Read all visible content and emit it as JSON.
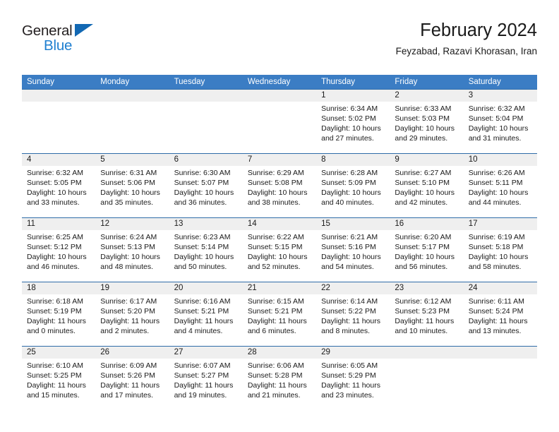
{
  "brand": {
    "name_top": "General",
    "name_bottom": "Blue",
    "color_black": "#231f20",
    "color_blue": "#1f7fd0"
  },
  "header": {
    "title": "February 2024",
    "location": "Feyzabad, Razavi Khorasan, Iran"
  },
  "theme": {
    "header_bar": "#3b7dc4",
    "row_divider": "#2f6ca8",
    "daynum_band": "#efefef",
    "text": "#1a1a1a"
  },
  "weekdays": [
    "Sunday",
    "Monday",
    "Tuesday",
    "Wednesday",
    "Thursday",
    "Friday",
    "Saturday"
  ],
  "weeks": [
    [
      {
        "day": "",
        "sunrise": "",
        "sunset": "",
        "daylight_1": "",
        "daylight_2": "",
        "empty": true
      },
      {
        "day": "",
        "sunrise": "",
        "sunset": "",
        "daylight_1": "",
        "daylight_2": "",
        "empty": true
      },
      {
        "day": "",
        "sunrise": "",
        "sunset": "",
        "daylight_1": "",
        "daylight_2": "",
        "empty": true
      },
      {
        "day": "",
        "sunrise": "",
        "sunset": "",
        "daylight_1": "",
        "daylight_2": "",
        "empty": true
      },
      {
        "day": "1",
        "sunrise": "Sunrise: 6:34 AM",
        "sunset": "Sunset: 5:02 PM",
        "daylight_1": "Daylight: 10 hours",
        "daylight_2": "and 27 minutes.",
        "empty": false
      },
      {
        "day": "2",
        "sunrise": "Sunrise: 6:33 AM",
        "sunset": "Sunset: 5:03 PM",
        "daylight_1": "Daylight: 10 hours",
        "daylight_2": "and 29 minutes.",
        "empty": false
      },
      {
        "day": "3",
        "sunrise": "Sunrise: 6:32 AM",
        "sunset": "Sunset: 5:04 PM",
        "daylight_1": "Daylight: 10 hours",
        "daylight_2": "and 31 minutes.",
        "empty": false
      }
    ],
    [
      {
        "day": "4",
        "sunrise": "Sunrise: 6:32 AM",
        "sunset": "Sunset: 5:05 PM",
        "daylight_1": "Daylight: 10 hours",
        "daylight_2": "and 33 minutes.",
        "empty": false
      },
      {
        "day": "5",
        "sunrise": "Sunrise: 6:31 AM",
        "sunset": "Sunset: 5:06 PM",
        "daylight_1": "Daylight: 10 hours",
        "daylight_2": "and 35 minutes.",
        "empty": false
      },
      {
        "day": "6",
        "sunrise": "Sunrise: 6:30 AM",
        "sunset": "Sunset: 5:07 PM",
        "daylight_1": "Daylight: 10 hours",
        "daylight_2": "and 36 minutes.",
        "empty": false
      },
      {
        "day": "7",
        "sunrise": "Sunrise: 6:29 AM",
        "sunset": "Sunset: 5:08 PM",
        "daylight_1": "Daylight: 10 hours",
        "daylight_2": "and 38 minutes.",
        "empty": false
      },
      {
        "day": "8",
        "sunrise": "Sunrise: 6:28 AM",
        "sunset": "Sunset: 5:09 PM",
        "daylight_1": "Daylight: 10 hours",
        "daylight_2": "and 40 minutes.",
        "empty": false
      },
      {
        "day": "9",
        "sunrise": "Sunrise: 6:27 AM",
        "sunset": "Sunset: 5:10 PM",
        "daylight_1": "Daylight: 10 hours",
        "daylight_2": "and 42 minutes.",
        "empty": false
      },
      {
        "day": "10",
        "sunrise": "Sunrise: 6:26 AM",
        "sunset": "Sunset: 5:11 PM",
        "daylight_1": "Daylight: 10 hours",
        "daylight_2": "and 44 minutes.",
        "empty": false
      }
    ],
    [
      {
        "day": "11",
        "sunrise": "Sunrise: 6:25 AM",
        "sunset": "Sunset: 5:12 PM",
        "daylight_1": "Daylight: 10 hours",
        "daylight_2": "and 46 minutes.",
        "empty": false
      },
      {
        "day": "12",
        "sunrise": "Sunrise: 6:24 AM",
        "sunset": "Sunset: 5:13 PM",
        "daylight_1": "Daylight: 10 hours",
        "daylight_2": "and 48 minutes.",
        "empty": false
      },
      {
        "day": "13",
        "sunrise": "Sunrise: 6:23 AM",
        "sunset": "Sunset: 5:14 PM",
        "daylight_1": "Daylight: 10 hours",
        "daylight_2": "and 50 minutes.",
        "empty": false
      },
      {
        "day": "14",
        "sunrise": "Sunrise: 6:22 AM",
        "sunset": "Sunset: 5:15 PM",
        "daylight_1": "Daylight: 10 hours",
        "daylight_2": "and 52 minutes.",
        "empty": false
      },
      {
        "day": "15",
        "sunrise": "Sunrise: 6:21 AM",
        "sunset": "Sunset: 5:16 PM",
        "daylight_1": "Daylight: 10 hours",
        "daylight_2": "and 54 minutes.",
        "empty": false
      },
      {
        "day": "16",
        "sunrise": "Sunrise: 6:20 AM",
        "sunset": "Sunset: 5:17 PM",
        "daylight_1": "Daylight: 10 hours",
        "daylight_2": "and 56 minutes.",
        "empty": false
      },
      {
        "day": "17",
        "sunrise": "Sunrise: 6:19 AM",
        "sunset": "Sunset: 5:18 PM",
        "daylight_1": "Daylight: 10 hours",
        "daylight_2": "and 58 minutes.",
        "empty": false
      }
    ],
    [
      {
        "day": "18",
        "sunrise": "Sunrise: 6:18 AM",
        "sunset": "Sunset: 5:19 PM",
        "daylight_1": "Daylight: 11 hours",
        "daylight_2": "and 0 minutes.",
        "empty": false
      },
      {
        "day": "19",
        "sunrise": "Sunrise: 6:17 AM",
        "sunset": "Sunset: 5:20 PM",
        "daylight_1": "Daylight: 11 hours",
        "daylight_2": "and 2 minutes.",
        "empty": false
      },
      {
        "day": "20",
        "sunrise": "Sunrise: 6:16 AM",
        "sunset": "Sunset: 5:21 PM",
        "daylight_1": "Daylight: 11 hours",
        "daylight_2": "and 4 minutes.",
        "empty": false
      },
      {
        "day": "21",
        "sunrise": "Sunrise: 6:15 AM",
        "sunset": "Sunset: 5:21 PM",
        "daylight_1": "Daylight: 11 hours",
        "daylight_2": "and 6 minutes.",
        "empty": false
      },
      {
        "day": "22",
        "sunrise": "Sunrise: 6:14 AM",
        "sunset": "Sunset: 5:22 PM",
        "daylight_1": "Daylight: 11 hours",
        "daylight_2": "and 8 minutes.",
        "empty": false
      },
      {
        "day": "23",
        "sunrise": "Sunrise: 6:12 AM",
        "sunset": "Sunset: 5:23 PM",
        "daylight_1": "Daylight: 11 hours",
        "daylight_2": "and 10 minutes.",
        "empty": false
      },
      {
        "day": "24",
        "sunrise": "Sunrise: 6:11 AM",
        "sunset": "Sunset: 5:24 PM",
        "daylight_1": "Daylight: 11 hours",
        "daylight_2": "and 13 minutes.",
        "empty": false
      }
    ],
    [
      {
        "day": "25",
        "sunrise": "Sunrise: 6:10 AM",
        "sunset": "Sunset: 5:25 PM",
        "daylight_1": "Daylight: 11 hours",
        "daylight_2": "and 15 minutes.",
        "empty": false
      },
      {
        "day": "26",
        "sunrise": "Sunrise: 6:09 AM",
        "sunset": "Sunset: 5:26 PM",
        "daylight_1": "Daylight: 11 hours",
        "daylight_2": "and 17 minutes.",
        "empty": false
      },
      {
        "day": "27",
        "sunrise": "Sunrise: 6:07 AM",
        "sunset": "Sunset: 5:27 PM",
        "daylight_1": "Daylight: 11 hours",
        "daylight_2": "and 19 minutes.",
        "empty": false
      },
      {
        "day": "28",
        "sunrise": "Sunrise: 6:06 AM",
        "sunset": "Sunset: 5:28 PM",
        "daylight_1": "Daylight: 11 hours",
        "daylight_2": "and 21 minutes.",
        "empty": false
      },
      {
        "day": "29",
        "sunrise": "Sunrise: 6:05 AM",
        "sunset": "Sunset: 5:29 PM",
        "daylight_1": "Daylight: 11 hours",
        "daylight_2": "and 23 minutes.",
        "empty": false
      },
      {
        "day": "",
        "sunrise": "",
        "sunset": "",
        "daylight_1": "",
        "daylight_2": "",
        "empty": true
      },
      {
        "day": "",
        "sunrise": "",
        "sunset": "",
        "daylight_1": "",
        "daylight_2": "",
        "empty": true
      }
    ]
  ]
}
